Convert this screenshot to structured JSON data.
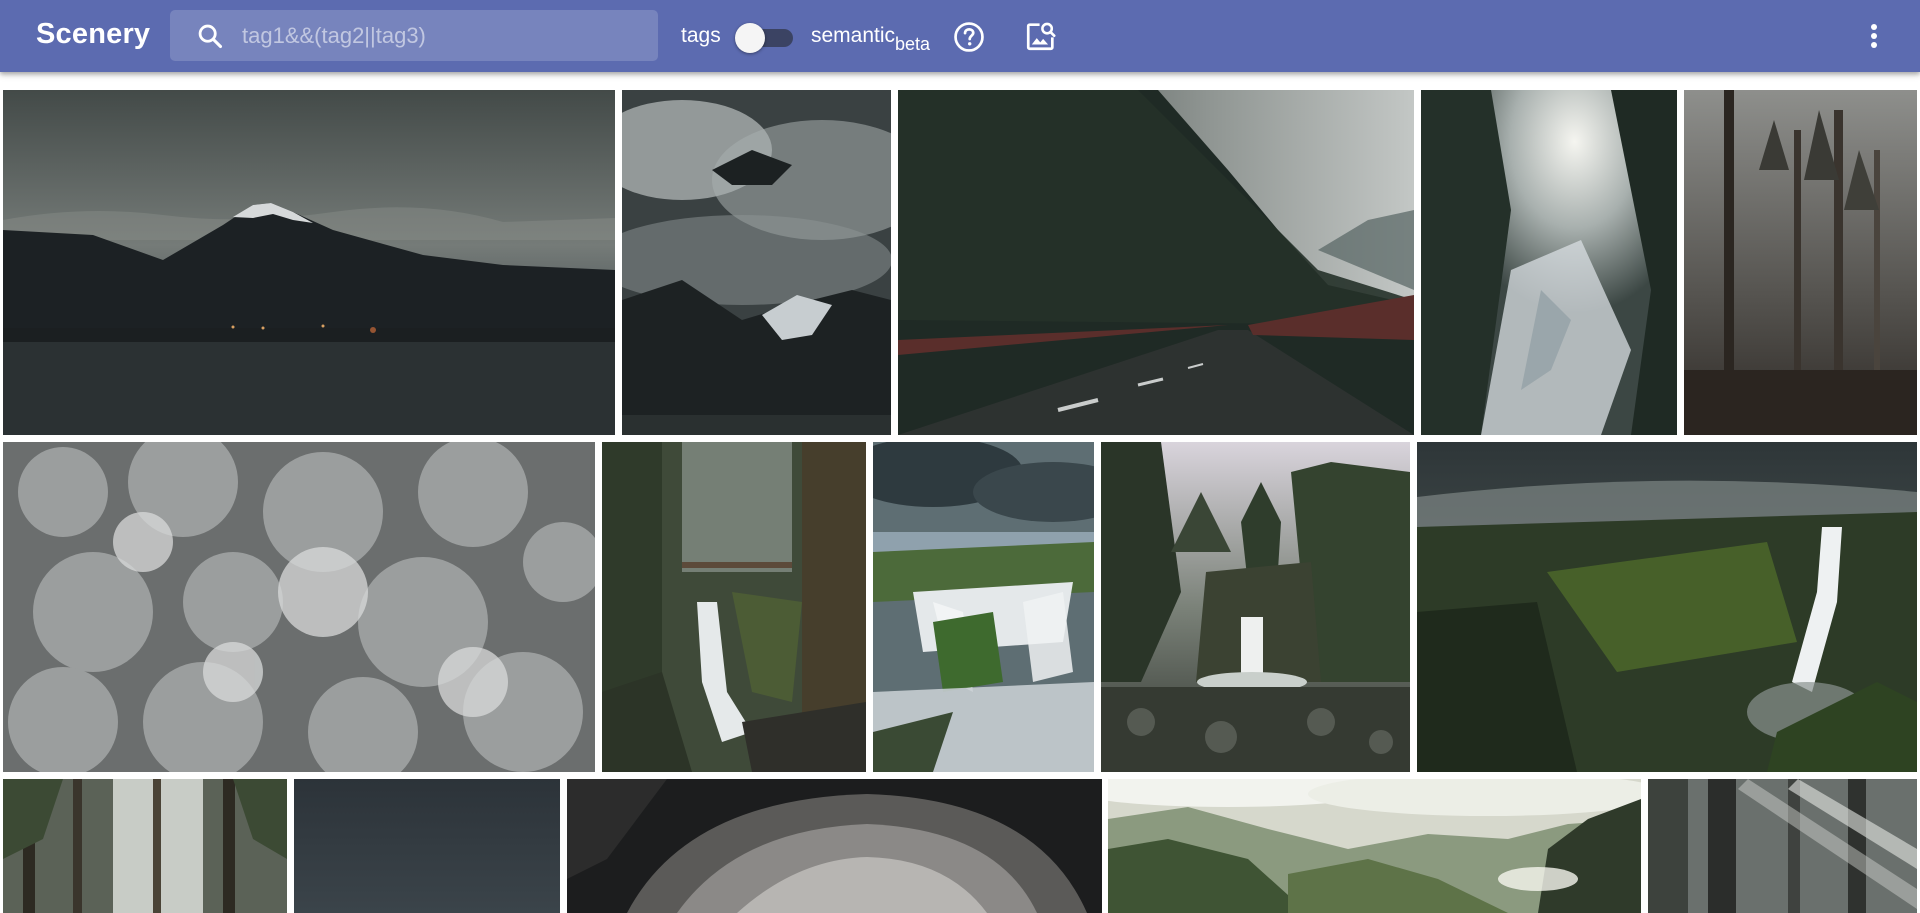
{
  "app": {
    "title": "Scenery"
  },
  "search": {
    "placeholder": "tag1&&(tag2||tag3)",
    "value": "",
    "icon": "search-icon"
  },
  "toggles": {
    "tags_label": "tags",
    "tags_enabled": false,
    "semantic_label": "semantic",
    "semantic_sub": "beta"
  },
  "actions": {
    "help_icon": "help-circle-icon",
    "image_search_icon": "image-search-icon",
    "more_icon": "more-vert-icon"
  },
  "colors": {
    "appbar": "#5c6bb0",
    "toggle_track": "#3b4363",
    "background": "#ffffff"
  },
  "photos": [
    {
      "subject": "mount-fuji-lake-dusk"
    },
    {
      "subject": "cloudy-snowy-mountain"
    },
    {
      "subject": "misty-forest-highway"
    },
    {
      "subject": "sunlit-snowy-forest"
    },
    {
      "subject": "foggy-pine-forest"
    },
    {
      "subject": "frosty-treetops-aerial"
    },
    {
      "subject": "mossy-gorge-bridge-waterfall"
    },
    {
      "subject": "tropical-cascading-falls"
    },
    {
      "subject": "forest-waterfall-cliff"
    },
    {
      "subject": "canyon-waterfall"
    },
    {
      "subject": "tall-forest-trees"
    },
    {
      "subject": "dark-night-sky"
    },
    {
      "subject": "storm-cloud"
    },
    {
      "subject": "green-mountain-valley"
    },
    {
      "subject": "sunbeam-forest"
    }
  ]
}
